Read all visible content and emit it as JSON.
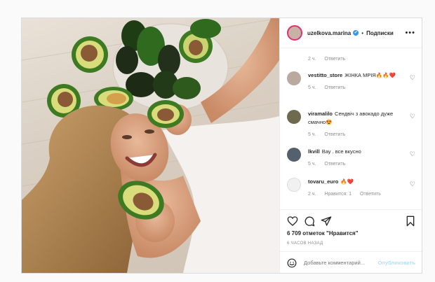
{
  "header": {
    "username": "uzelkova.marina",
    "verified_mark": "✔",
    "separator": "•",
    "follow_label": "Подписки",
    "more_icon": "more-icon"
  },
  "comments": [
    {
      "user": "",
      "text": "",
      "time": "2 ч.",
      "reply": "Ответить",
      "likes": ""
    },
    {
      "user": "vestitto_store",
      "text": "ЖІНКА МРІЯ🔥🔥❤️",
      "time": "5 ч.",
      "reply": "Ответить",
      "likes": ""
    },
    {
      "user": "viramalilo",
      "text": "Сендвіч з авокадо дуже смачно😍",
      "time": "5 ч.",
      "reply": "Ответить",
      "likes": ""
    },
    {
      "user": "lkvill",
      "text": "Вау . все вкусно",
      "time": "5 ч.",
      "reply": "Ответить",
      "likes": ""
    },
    {
      "user": "tovaru_euro",
      "text": "🔥❤️",
      "time": "2 ч.",
      "reply": "Ответить",
      "likes": "Нравится: 1"
    }
  ],
  "actions": {
    "likes_text": "6 709 отметок \"Нравится\"",
    "time_ago": "6 ЧАСОВ НАЗАД"
  },
  "add_comment": {
    "placeholder": "Добавьте комментарий...",
    "publish_label": "Опубликовать"
  },
  "colors": {
    "accent": "#3897f0",
    "publish_disabled": "#b2dffc",
    "avocado_skin": "#2f5a1e",
    "avocado_flesh": "#c9d470",
    "avocado_pit": "#8a5a36"
  }
}
